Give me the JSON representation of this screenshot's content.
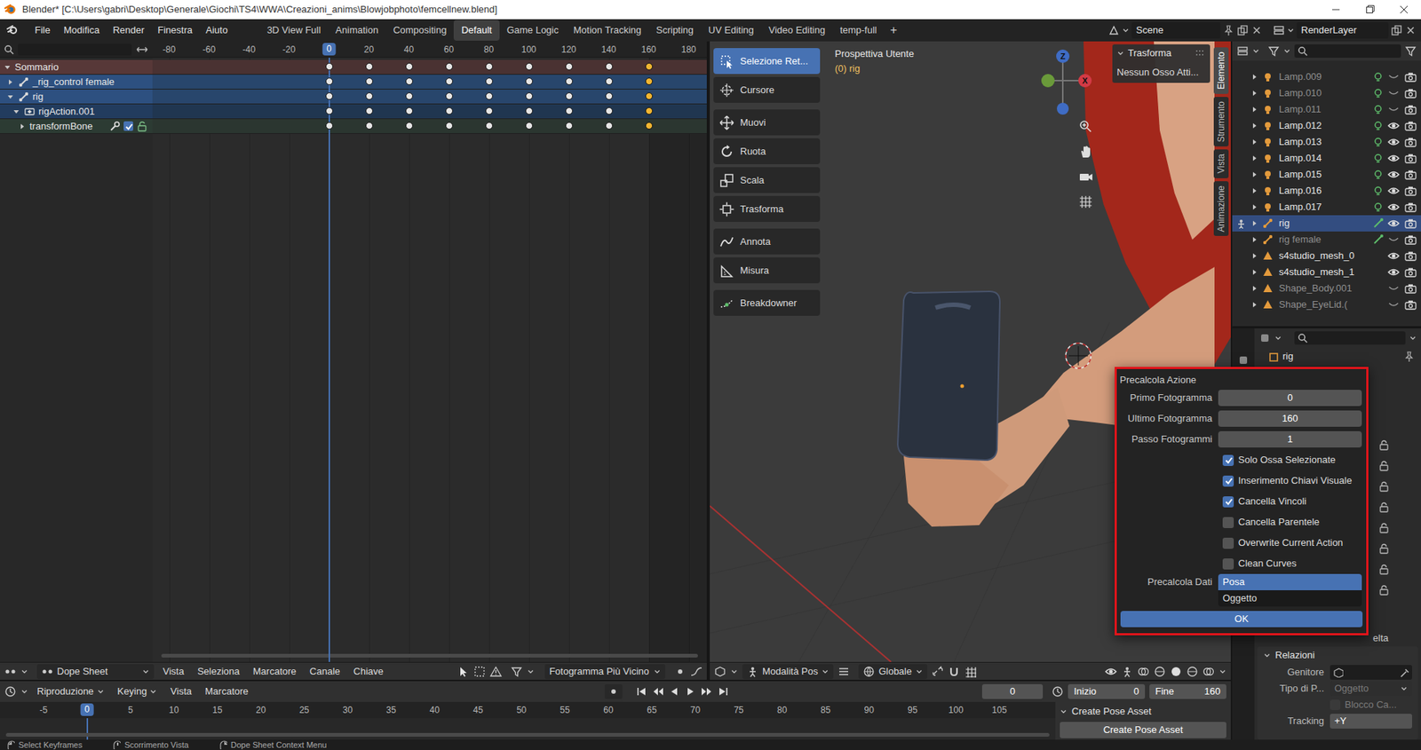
{
  "window": {
    "title": "Blender* [C:\\Users\\gabri\\Desktop\\Generale\\Giochi\\TS4\\WWA\\Creazioni_anims\\Blowjobphoto\\femcellnew.blend]"
  },
  "menu": [
    "File",
    "Modifica",
    "Render",
    "Finestra",
    "Aiuto"
  ],
  "workspaces": [
    {
      "label": "3D View Full",
      "selected": false
    },
    {
      "label": "Animation",
      "selected": false
    },
    {
      "label": "Compositing",
      "selected": false
    },
    {
      "label": "Default",
      "selected": true
    },
    {
      "label": "Game Logic",
      "selected": false
    },
    {
      "label": "Motion Tracking",
      "selected": false
    },
    {
      "label": "Scripting",
      "selected": false
    },
    {
      "label": "UV Editing",
      "selected": false
    },
    {
      "label": "Video Editing",
      "selected": false
    },
    {
      "label": "temp-full",
      "selected": false
    }
  ],
  "workspace_add": "+",
  "scene": "Scene",
  "view_layer": "RenderLayer",
  "dopesheet": {
    "ruler": [
      "-80",
      "-60",
      "-40",
      "-20",
      "20",
      "40",
      "60",
      "80",
      "100",
      "120",
      "140",
      "160",
      "180"
    ],
    "current_frame": "0",
    "channels": [
      {
        "name": "Sommario",
        "kind": "summary",
        "expanded": true
      },
      {
        "name": "_rig_control female",
        "kind": "object",
        "expanded": false
      },
      {
        "name": "rig",
        "kind": "object",
        "expanded": true
      },
      {
        "name": "rigAction.001",
        "kind": "action",
        "expanded": true
      },
      {
        "name": "transformBone",
        "kind": "group",
        "expanded": false,
        "enabled": true
      }
    ],
    "keyframes": [
      {
        "frame": 0,
        "selected": false
      },
      {
        "frame": 20,
        "selected": false
      },
      {
        "frame": 40,
        "selected": false
      },
      {
        "frame": 60,
        "selected": false
      },
      {
        "frame": 80,
        "selected": false
      },
      {
        "frame": 100,
        "selected": false
      },
      {
        "frame": 120,
        "selected": false
      },
      {
        "frame": 140,
        "selected": false
      },
      {
        "frame": 160,
        "selected": true
      }
    ],
    "header": {
      "editor": "Dope Sheet",
      "menus": [
        "Vista",
        "Seleziona",
        "Marcatore",
        "Canale",
        "Chiave"
      ],
      "snap": "Fotogramma Più Vicino"
    }
  },
  "viewport": {
    "view": "Prospettiva Utente",
    "active": "(0) rig",
    "tool_groups": [
      [
        {
          "label": "Selezione Ret...",
          "selected": true
        },
        {
          "label": "Cursore",
          "selected": false
        }
      ],
      [
        {
          "label": "Muovi",
          "selected": false
        },
        {
          "label": "Ruota",
          "selected": false
        },
        {
          "label": "Scala",
          "selected": false
        },
        {
          "label": "Trasforma",
          "selected": false
        }
      ],
      [
        {
          "label": "Annota",
          "selected": false
        },
        {
          "label": "Misura",
          "selected": false
        }
      ],
      [
        {
          "label": "Breakdowner",
          "selected": false
        }
      ]
    ],
    "gizmo": {
      "z": "Z",
      "x": "X"
    },
    "npanel": {
      "title": "Trasforma",
      "message": "Nessun Osso Atti..."
    },
    "tabs": [
      {
        "label": "Elemento",
        "selected": true
      },
      {
        "label": "Strumento",
        "selected": false
      },
      {
        "label": "Vista",
        "selected": false
      },
      {
        "label": "Animazione",
        "selected": false
      }
    ],
    "header": {
      "mode": "Modalità Pos",
      "orientation": "Globale"
    }
  },
  "outliner": {
    "rows": [
      {
        "name": "Lamp.009",
        "kind": "lamp",
        "visible": false,
        "selected": false
      },
      {
        "name": "Lamp.010",
        "kind": "lamp",
        "visible": false,
        "selected": false
      },
      {
        "name": "Lamp.011",
        "kind": "lamp",
        "visible": false,
        "selected": false
      },
      {
        "name": "Lamp.012",
        "kind": "lamp",
        "visible": true,
        "selected": false
      },
      {
        "name": "Lamp.013",
        "kind": "lamp",
        "visible": true,
        "selected": false
      },
      {
        "name": "Lamp.014",
        "kind": "lamp",
        "visible": true,
        "selected": false
      },
      {
        "name": "Lamp.015",
        "kind": "lamp",
        "visible": true,
        "selected": false
      },
      {
        "name": "Lamp.016",
        "kind": "lamp",
        "visible": true,
        "selected": false
      },
      {
        "name": "Lamp.017",
        "kind": "lamp",
        "visible": true,
        "selected": false
      },
      {
        "name": "rig",
        "kind": "armature",
        "visible": true,
        "selected": true
      },
      {
        "name": "rig female",
        "kind": "armature",
        "visible": false,
        "selected": false
      },
      {
        "name": "s4studio_mesh_0",
        "kind": "mesh",
        "visible": true,
        "selected": false
      },
      {
        "name": "s4studio_mesh_1",
        "kind": "mesh",
        "visible": true,
        "selected": false
      },
      {
        "name": "Shape_Body.001",
        "kind": "mesh",
        "visible": false,
        "selected": false
      },
      {
        "name": "Shape_EyeLid.(",
        "kind": "mesh",
        "visible": false,
        "selected": false
      }
    ]
  },
  "properties": {
    "object": "rig",
    "cut_label": "elta",
    "relations": {
      "title": "Relazioni",
      "parent_label": "Genitore",
      "parent_type_label": "Tipo di P...",
      "parent_type": "Oggetto",
      "parent_type_disabled": true,
      "lock_label": "Blocco Ca...",
      "lock_checked": false,
      "lock_disabled": true,
      "tracking_label": "Tracking",
      "tracking": "+Y"
    }
  },
  "timeline": {
    "menus": [
      {
        "label": "Riproduzione",
        "dropdown": true
      },
      {
        "label": "Keying",
        "dropdown": true
      },
      {
        "label": "Vista",
        "dropdown": false
      },
      {
        "label": "Marcatore",
        "dropdown": false
      }
    ],
    "frame": "0",
    "start_label": "Inizio",
    "start": "0",
    "end_label": "Fine",
    "end": "160",
    "current_frame": "0",
    "ruler": [
      "-5",
      "5",
      "10",
      "15",
      "20",
      "25",
      "30",
      "35",
      "40",
      "45",
      "50",
      "55",
      "60",
      "65",
      "70",
      "75",
      "80",
      "85",
      "90",
      "95",
      "100",
      "105"
    ],
    "pose_panel": {
      "title": "Create Pose Asset",
      "button": "Create Pose Asset"
    }
  },
  "bake_dialog": {
    "title": "Precalcola Azione",
    "fields": [
      {
        "label": "Primo Fotogramma",
        "value": "0"
      },
      {
        "label": "Ultimo Fotogramma",
        "value": "160"
      },
      {
        "label": "Passo Fotogrammi",
        "value": "1"
      }
    ],
    "options": [
      {
        "label": "Solo Ossa Selezionate",
        "checked": true
      },
      {
        "label": "Inserimento Chiavi Visuale",
        "checked": true
      },
      {
        "label": "Cancella Vincoli",
        "checked": true
      },
      {
        "label": "Cancella Parentele",
        "checked": false
      },
      {
        "label": "Overwrite Current Action",
        "checked": false
      },
      {
        "label": "Clean Curves",
        "checked": false
      }
    ],
    "bake_data_label": "Precalcola Dati",
    "bake_data": [
      {
        "label": "Posa",
        "selected": true
      },
      {
        "label": "Oggetto",
        "selected": false
      }
    ],
    "confirm": "OK"
  },
  "status_bar": [
    "Select Keyframes",
    "Scorrimento Vista",
    "Dope Sheet Context Menu"
  ]
}
